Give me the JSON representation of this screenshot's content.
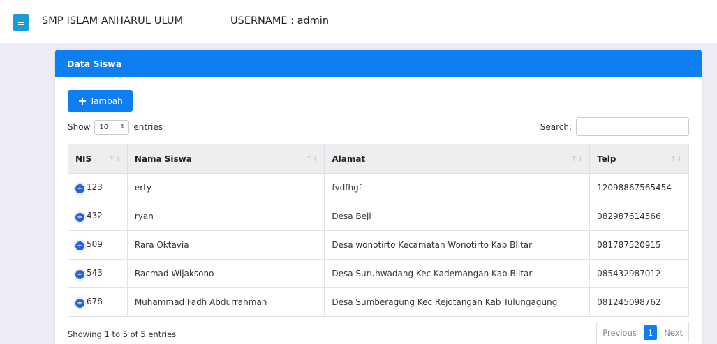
{
  "topbar": {
    "app_title": "SMP ISLAM ANHARUL ULUM",
    "username": "USERNAME : admin",
    "menu_icon": "menu-icon"
  },
  "card": {
    "title": "Data Siswa",
    "add_button": "Tambah",
    "show_label": "Show",
    "entries_value": "10",
    "entries_label": "entries",
    "search_label": "Search:",
    "search_value": ""
  },
  "table": {
    "columns": [
      "NIS",
      "Nama Siswa",
      "Alamat",
      "Telp"
    ],
    "rows": [
      {
        "nis": "123",
        "nama": "erty",
        "alamat": "fvdfhgf",
        "telp": "12098867565454"
      },
      {
        "nis": "432",
        "nama": "ryan",
        "alamat": "Desa Beji",
        "telp": "082987614566"
      },
      {
        "nis": "509",
        "nama": "Rara Oktavia",
        "alamat": "Desa wonotirto Kecamatan Wonotirto Kab Blitar",
        "telp": "081787520915"
      },
      {
        "nis": "543",
        "nama": "Racmad Wijaksono",
        "alamat": "Desa Suruhwadang Kec Kademangan Kab Blitar",
        "telp": "085432987012"
      },
      {
        "nis": "678",
        "nama": "Muhammad Fadh Abdurrahman",
        "alamat": "Desa Sumberagung Kec Rejotangan Kab Tulungagung",
        "telp": "081245098762"
      }
    ]
  },
  "footer": {
    "info": "Showing 1 to 5 of 5 entries",
    "previous": "Previous",
    "page": "1",
    "next": "Next"
  },
  "colors": {
    "primary": "#0d7ff2",
    "menu_button": "#1b9ad6",
    "background": "#eeecf7"
  }
}
